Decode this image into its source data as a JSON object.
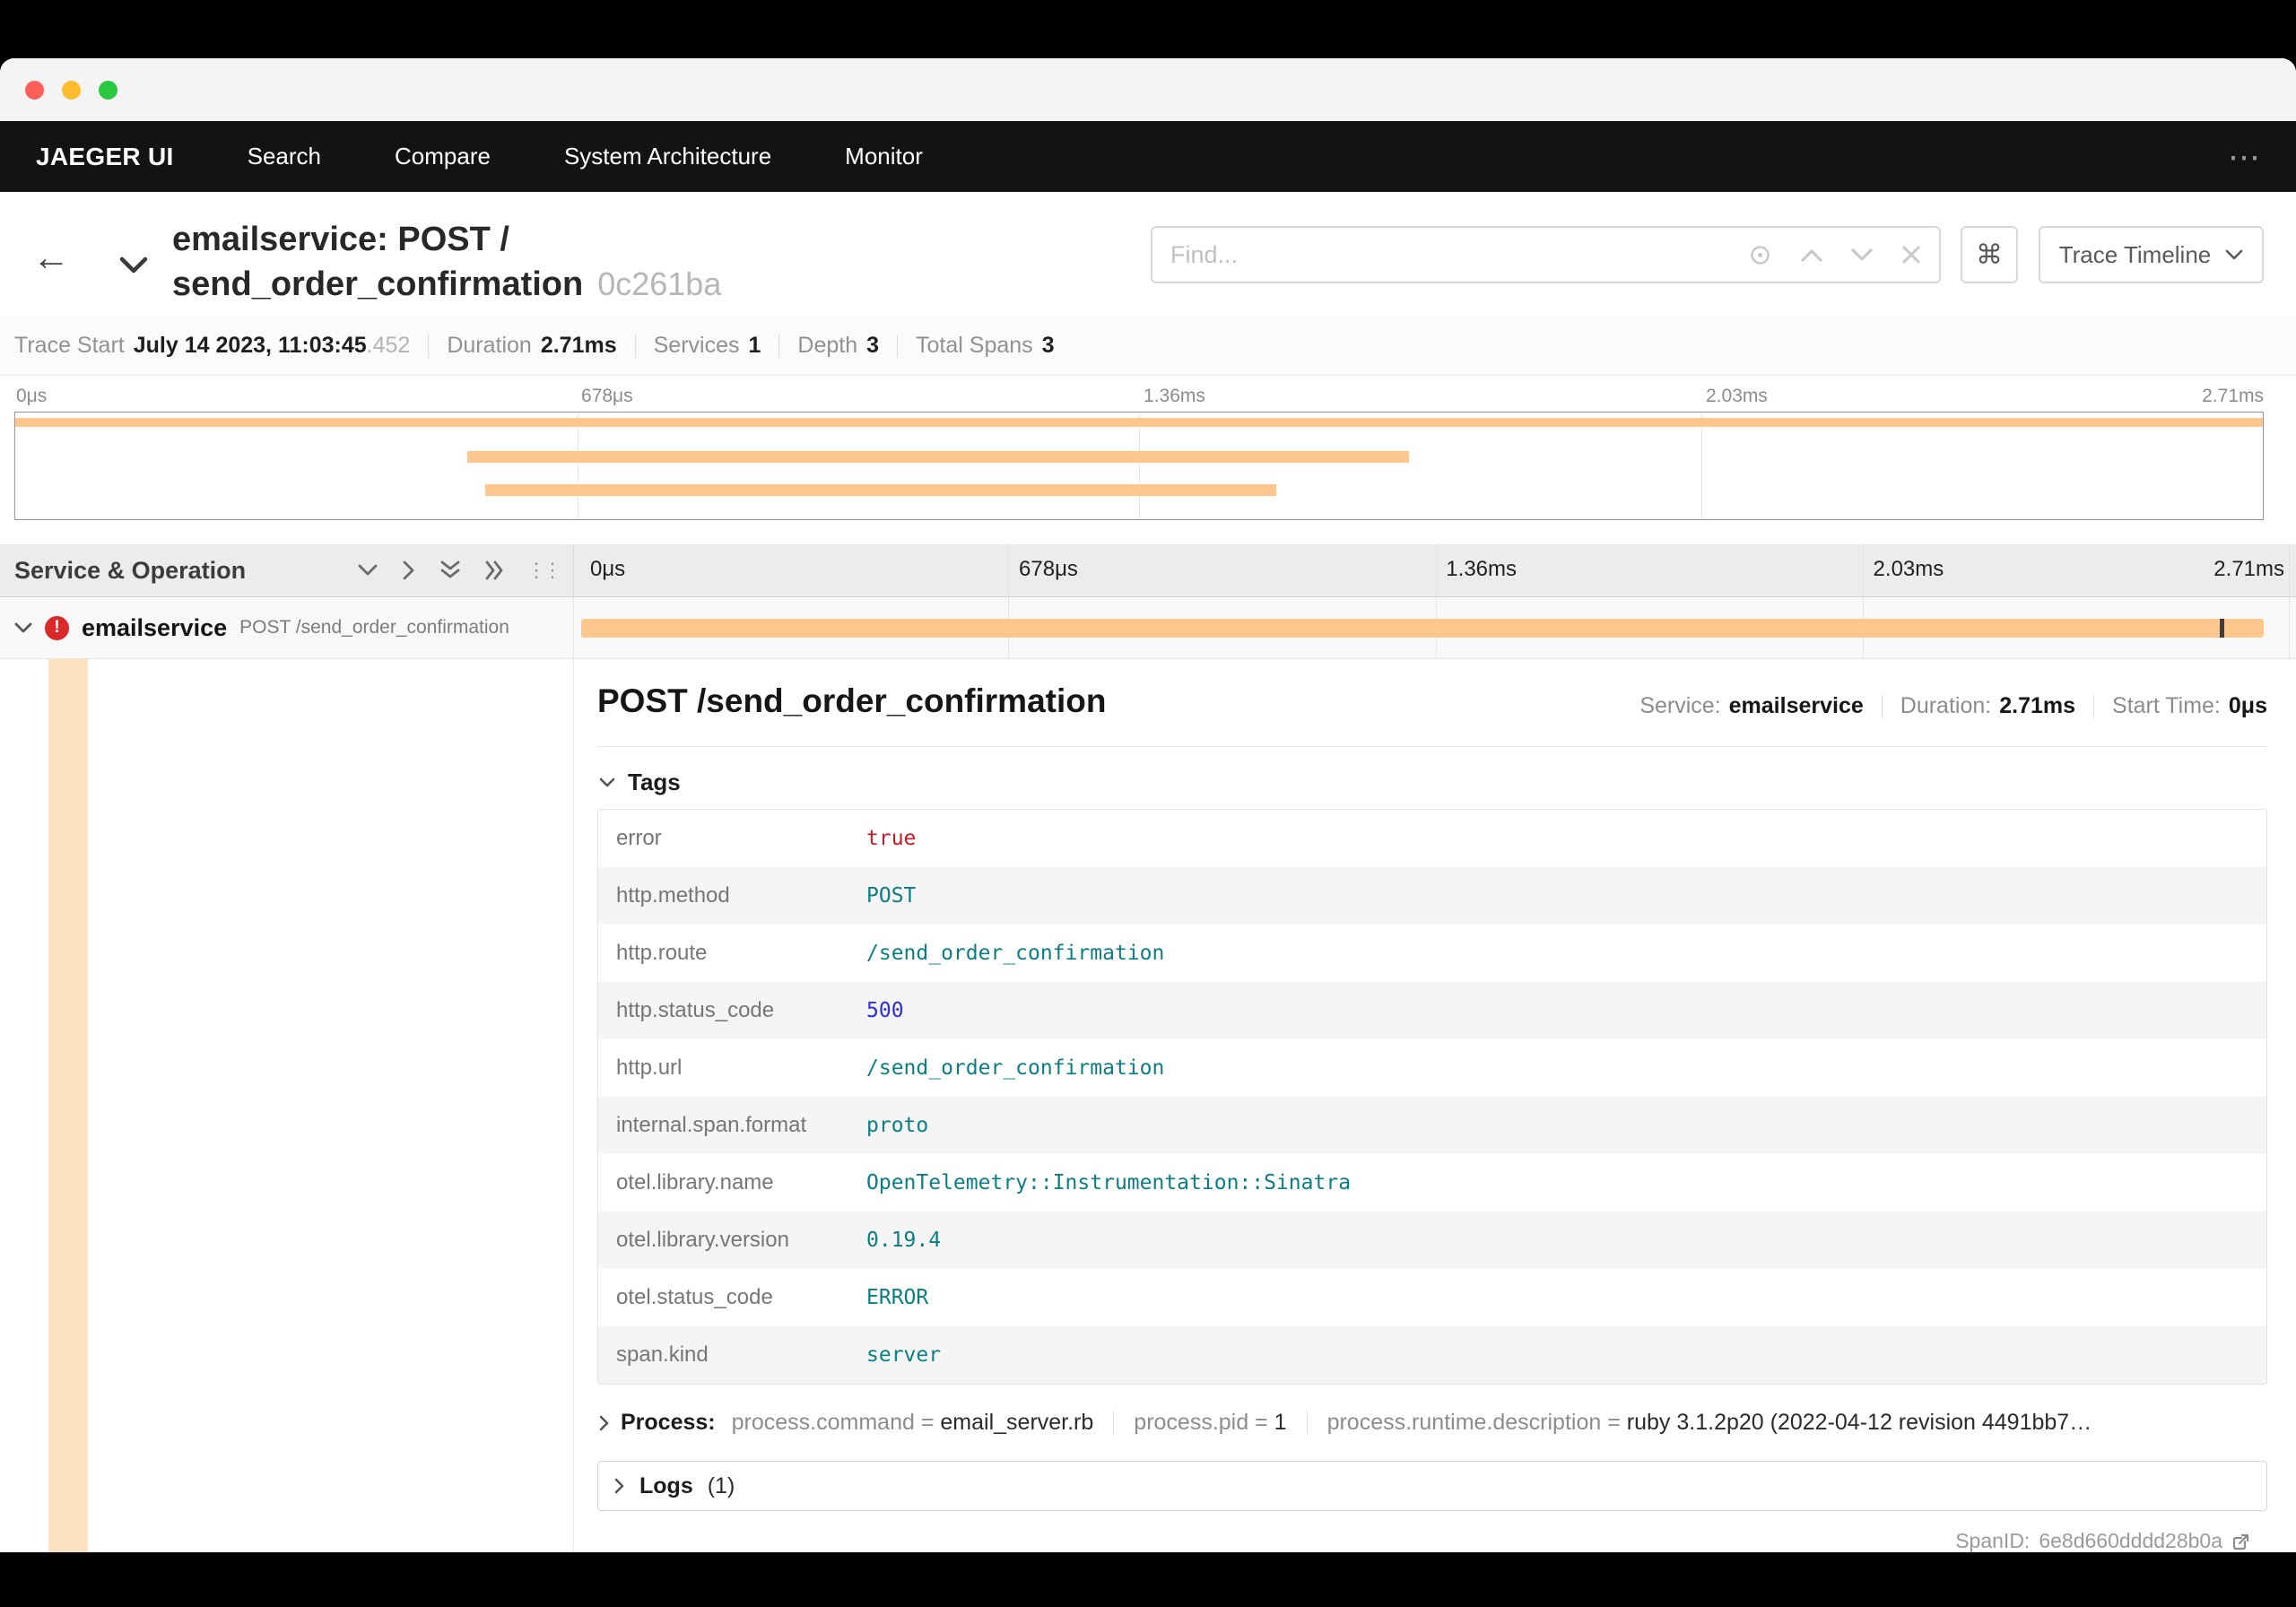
{
  "nav": {
    "brand": "JAEGER UI",
    "items": [
      "Search",
      "Compare",
      "System Architecture",
      "Monitor"
    ],
    "overflow": "⋯"
  },
  "header": {
    "back_arrow": "←",
    "title_line1": "emailservice: POST /",
    "title_line2": "send_order_confirmation",
    "trace_id_short": "0c261ba",
    "find_placeholder": "Find...",
    "shortcut_key": "⌘",
    "view_selector": "Trace Timeline"
  },
  "summary": {
    "items": [
      {
        "label": "Trace Start",
        "value": "July 14 2023, 11:03:45",
        "suffix": ".452"
      },
      {
        "label": "Duration",
        "value": "2.71ms"
      },
      {
        "label": "Services",
        "value": "1"
      },
      {
        "label": "Depth",
        "value": "3"
      },
      {
        "label": "Total Spans",
        "value": "3"
      }
    ]
  },
  "timeline": {
    "ticks": [
      "0μs",
      "678μs",
      "1.36ms",
      "2.03ms",
      "2.71ms"
    ],
    "left_header": "Service & Operation",
    "minimap_spans": [
      {
        "start_pct": 0,
        "width_pct": 100
      },
      {
        "start_pct": 20.1,
        "width_pct": 41.9
      },
      {
        "start_pct": 20.9,
        "width_pct": 35.2
      }
    ],
    "row": {
      "service": "emailservice",
      "operation": "POST /send_order_confirmation",
      "bar": {
        "start_pct": 0,
        "width_pct": 98.5
      },
      "cursor_pct": 95.9
    }
  },
  "detail": {
    "title": "POST /send_order_confirmation",
    "meta": [
      {
        "label": "Service:",
        "value": "emailservice"
      },
      {
        "label": "Duration:",
        "value": "2.71ms"
      },
      {
        "label": "Start Time:",
        "value": "0μs"
      }
    ],
    "tags": {
      "header": "Tags",
      "rows": [
        {
          "key": "error",
          "value": "true",
          "type": "boolean"
        },
        {
          "key": "http.method",
          "value": "POST",
          "type": "string"
        },
        {
          "key": "http.route",
          "value": "/send_order_confirmation",
          "type": "string"
        },
        {
          "key": "http.status_code",
          "value": "500",
          "type": "number"
        },
        {
          "key": "http.url",
          "value": "/send_order_confirmation",
          "type": "string"
        },
        {
          "key": "internal.span.format",
          "value": "proto",
          "type": "string"
        },
        {
          "key": "otel.library.name",
          "value": "OpenTelemetry::Instrumentation::Sinatra",
          "type": "string"
        },
        {
          "key": "otel.library.version",
          "value": "0.19.4",
          "type": "string"
        },
        {
          "key": "otel.status_code",
          "value": "ERROR",
          "type": "string"
        },
        {
          "key": "span.kind",
          "value": "server",
          "type": "string"
        }
      ]
    },
    "process": {
      "header": "Process:",
      "equals": "=",
      "items": [
        {
          "key": "process.command",
          "value": "email_server.rb"
        },
        {
          "key": "process.pid",
          "value": "1"
        },
        {
          "key": "process.runtime.description",
          "value": "ruby 3.1.2p20 (2022-04-12 revision 4491bb7…"
        }
      ]
    },
    "logs": {
      "header": "Logs",
      "count": "(1)"
    },
    "span_id": {
      "label": "SpanID:",
      "value": "6e8d660dddd28b0a"
    }
  },
  "colors": {
    "topnav_bg": "#131316",
    "span_bar_orange": "#fdc78e",
    "indent_band": "#fce4c2",
    "error_red": "#db2828",
    "tag_string_teal": "#0b7e84",
    "tag_number_blue": "#2d2de0",
    "tag_boolean_red": "#c41d25"
  }
}
